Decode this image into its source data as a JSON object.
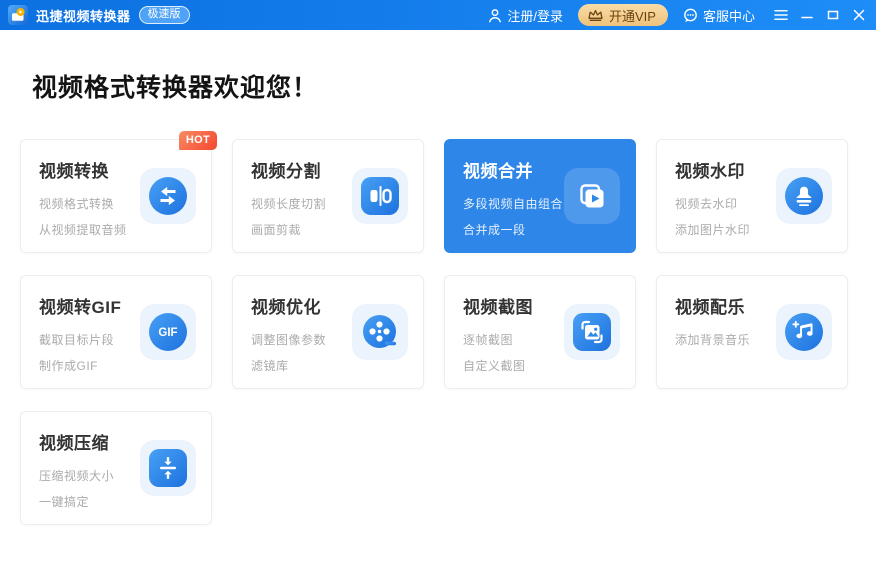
{
  "titlebar": {
    "app_title": "迅捷视频转换器",
    "edition_badge": "极速版",
    "register_login_label": "注册/登录",
    "vip_label": "开通VIP",
    "support_label": "客服中心"
  },
  "heading": "视频格式转换器欢迎您！",
  "cards": [
    {
      "title": "视频转换",
      "lines": [
        "视频格式转换",
        "从视频提取音频"
      ],
      "icon": "swap-icon",
      "badge": "HOT",
      "active": false
    },
    {
      "title": "视频分割",
      "lines": [
        "视频长度切割",
        "画面剪裁"
      ],
      "icon": "split-icon",
      "active": false
    },
    {
      "title": "视频合并",
      "lines": [
        "多段视频自由组合",
        "合并成一段"
      ],
      "icon": "merge-icon",
      "active": true
    },
    {
      "title": "视频水印",
      "lines": [
        "视频去水印",
        "添加图片水印"
      ],
      "icon": "stamp-icon",
      "active": false
    },
    {
      "title": "视频转GIF",
      "lines": [
        "截取目标片段",
        "制作成GIF"
      ],
      "icon": "gif-icon",
      "icon_text": "GIF",
      "active": false
    },
    {
      "title": "视频优化",
      "lines": [
        "调整图像参数",
        "滤镜库"
      ],
      "icon": "film-reel-icon",
      "active": false
    },
    {
      "title": "视频截图",
      "lines": [
        "逐帧截图",
        "自定义截图"
      ],
      "icon": "screenshot-icon",
      "active": false
    },
    {
      "title": "视频配乐",
      "lines": [
        "添加背景音乐"
      ],
      "icon": "music-plus-icon",
      "active": false
    },
    {
      "title": "视频压缩",
      "lines": [
        "压缩视频大小",
        "一键搞定"
      ],
      "icon": "compress-icon",
      "active": false
    }
  ],
  "colors": {
    "titlebar_blue_start": "#0C70E1",
    "titlebar_blue_end": "#1E8DF7",
    "accent_blue": "#2E86E9",
    "icon_gradient_start": "#47A0F5",
    "icon_gradient_end": "#1D72DD",
    "icon_tile_bg": "#EBF3FD",
    "hot_badge_red": "#F4472E",
    "vip_gold": "#EFC27C",
    "vip_text_brown": "#6A4312",
    "subtitle_gray": "#ABABAB"
  }
}
